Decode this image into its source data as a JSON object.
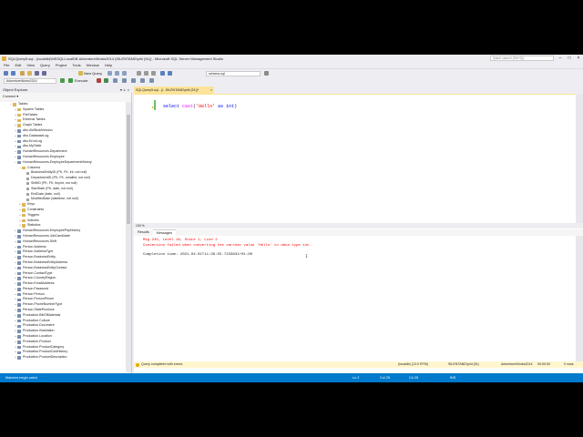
{
  "window": {
    "title": "SQLQuery5.sql - (localdb)\\MSSQLLocalDB.AdventureWorks2014 (SILENTAND\\phil (51)) - Microsoft SQL Server Management Studio",
    "quick_launch": "Quick Launch (Ctrl+Q)"
  },
  "menu": [
    "File",
    "Edit",
    "View",
    "Query",
    "Project",
    "Tools",
    "Window",
    "Help"
  ],
  "toolbar": {
    "new_query": "New Query",
    "object_combo": "schema.sql",
    "database_combo": "AdventureWorks2014",
    "execute": "Execute"
  },
  "object_explorer": {
    "title": "Object Explorer",
    "connect": "Connect ▾",
    "tree": [
      {
        "indent": 2,
        "exp": "−",
        "icon": "folder",
        "label": "Tables"
      },
      {
        "indent": 3,
        "exp": "+",
        "icon": "folder",
        "label": "System Tables"
      },
      {
        "indent": 3,
        "exp": "+",
        "icon": "folder",
        "label": "FileTables"
      },
      {
        "indent": 3,
        "exp": "+",
        "icon": "folder",
        "label": "External Tables"
      },
      {
        "indent": 3,
        "exp": "+",
        "icon": "folder",
        "label": "Graph Tables"
      },
      {
        "indent": 3,
        "exp": "+",
        "icon": "table",
        "label": "dbo.AWBuildVersion"
      },
      {
        "indent": 3,
        "exp": "+",
        "icon": "table",
        "label": "dbo.DatabaseLog"
      },
      {
        "indent": 3,
        "exp": "+",
        "icon": "table",
        "label": "dbo.ErrorLog"
      },
      {
        "indent": 3,
        "exp": "+",
        "icon": "table",
        "label": "dbo.MyTable"
      },
      {
        "indent": 3,
        "exp": "+",
        "icon": "table",
        "label": "HumanResources.Department"
      },
      {
        "indent": 3,
        "exp": "+",
        "icon": "table",
        "label": "HumanResources.Employee"
      },
      {
        "indent": 3,
        "exp": "−",
        "icon": "table",
        "label": "HumanResources.EmployeeDepartmentHistory"
      },
      {
        "indent": 4,
        "exp": "−",
        "icon": "folder",
        "label": "Columns"
      },
      {
        "indent": 5,
        "exp": "",
        "icon": "col",
        "label": "BusinessEntityID (PK, FK, int, not null)"
      },
      {
        "indent": 5,
        "exp": "",
        "icon": "col",
        "label": "DepartmentID (PK, FK, smallint, not null)"
      },
      {
        "indent": 5,
        "exp": "",
        "icon": "col",
        "label": "ShiftID (PK, FK, tinyint, not null)"
      },
      {
        "indent": 5,
        "exp": "",
        "icon": "col",
        "label": "StartDate (PK, date, not null)"
      },
      {
        "indent": 5,
        "exp": "",
        "icon": "col",
        "label": "EndDate (date, null)"
      },
      {
        "indent": 5,
        "exp": "",
        "icon": "col",
        "label": "ModifiedDate (datetime, not null)"
      },
      {
        "indent": 4,
        "exp": "+",
        "icon": "folder",
        "label": "Keys"
      },
      {
        "indent": 4,
        "exp": "+",
        "icon": "folder",
        "label": "Constraints"
      },
      {
        "indent": 4,
        "exp": "+",
        "icon": "folder",
        "label": "Triggers"
      },
      {
        "indent": 4,
        "exp": "+",
        "icon": "folder",
        "label": "Indexes"
      },
      {
        "indent": 4,
        "exp": "+",
        "icon": "folder",
        "label": "Statistics"
      },
      {
        "indent": 3,
        "exp": "+",
        "icon": "table",
        "label": "HumanResources.EmployeePayHistory"
      },
      {
        "indent": 3,
        "exp": "+",
        "icon": "table",
        "label": "HumanResources.JobCandidate"
      },
      {
        "indent": 3,
        "exp": "+",
        "icon": "table",
        "label": "HumanResources.Shift"
      },
      {
        "indent": 3,
        "exp": "+",
        "icon": "table",
        "label": "Person.Address"
      },
      {
        "indent": 3,
        "exp": "+",
        "icon": "table",
        "label": "Person.AddressType"
      },
      {
        "indent": 3,
        "exp": "+",
        "icon": "table",
        "label": "Person.BusinessEntity"
      },
      {
        "indent": 3,
        "exp": "+",
        "icon": "table",
        "label": "Person.BusinessEntityAddress"
      },
      {
        "indent": 3,
        "exp": "+",
        "icon": "table",
        "label": "Person.BusinessEntityContact"
      },
      {
        "indent": 3,
        "exp": "+",
        "icon": "table",
        "label": "Person.ContactType"
      },
      {
        "indent": 3,
        "exp": "+",
        "icon": "table",
        "label": "Person.CountryRegion"
      },
      {
        "indent": 3,
        "exp": "+",
        "icon": "table",
        "label": "Person.EmailAddress"
      },
      {
        "indent": 3,
        "exp": "+",
        "icon": "table",
        "label": "Person.Password"
      },
      {
        "indent": 3,
        "exp": "+",
        "icon": "table",
        "label": "Person.Person"
      },
      {
        "indent": 3,
        "exp": "+",
        "icon": "table",
        "label": "Person.PersonPhone"
      },
      {
        "indent": 3,
        "exp": "+",
        "icon": "table",
        "label": "Person.PhoneNumberType"
      },
      {
        "indent": 3,
        "exp": "+",
        "icon": "table",
        "label": "Person.StateProvince"
      },
      {
        "indent": 3,
        "exp": "+",
        "icon": "table",
        "label": "Production.BillOfMaterials"
      },
      {
        "indent": 3,
        "exp": "+",
        "icon": "table",
        "label": "Production.Culture"
      },
      {
        "indent": 3,
        "exp": "+",
        "icon": "table",
        "label": "Production.Document"
      },
      {
        "indent": 3,
        "exp": "+",
        "icon": "table",
        "label": "Production.Illustration"
      },
      {
        "indent": 3,
        "exp": "+",
        "icon": "table",
        "label": "Production.Location"
      },
      {
        "indent": 3,
        "exp": "+",
        "icon": "table",
        "label": "Production.Product"
      },
      {
        "indent": 3,
        "exp": "+",
        "icon": "table",
        "label": "Production.ProductCategory"
      },
      {
        "indent": 3,
        "exp": "+",
        "icon": "table",
        "label": "Production.ProductCostHistory"
      },
      {
        "indent": 3,
        "exp": "+",
        "icon": "table",
        "label": "Production.ProductDescription"
      }
    ]
  },
  "editor": {
    "tab_label": "SQLQuery5.sql - (l...SILENTAND\\phil (51))*",
    "tab_close": "×",
    "code": {
      "kw1": "select",
      "fn": "cast",
      "open": "(",
      "str": "'Hello'",
      "kw2": " as ",
      "kw3": "int",
      "close": ")"
    },
    "zoom": "100 %"
  },
  "results": {
    "tabs": [
      "Results",
      "Messages"
    ],
    "error_line1": "Msg 245, Level 16, State 1, Line 2",
    "error_line2": "Conversion failed when converting the varchar value 'Hello' to data type int.",
    "completion": "Completion time: 2021-04-01T11:39:55.7233831+01:00"
  },
  "query_status": {
    "message": "Query completed with errors.",
    "server": "(localdb) (13.0 RTM)",
    "user": "SILENTAND\\phil (51)",
    "database": "AdventureWorks2014",
    "elapsed": "00:00:00",
    "rows": "0 rows"
  },
  "app_status": {
    "left": "Matches begin catch",
    "ln": "Ln 2",
    "col": "Col 25",
    "ch": "Ch 25",
    "mode": "INS"
  },
  "colors": {
    "status_blue": "#007acc",
    "tab_yellow": "#fce49a",
    "error_red": "#ff0000"
  }
}
